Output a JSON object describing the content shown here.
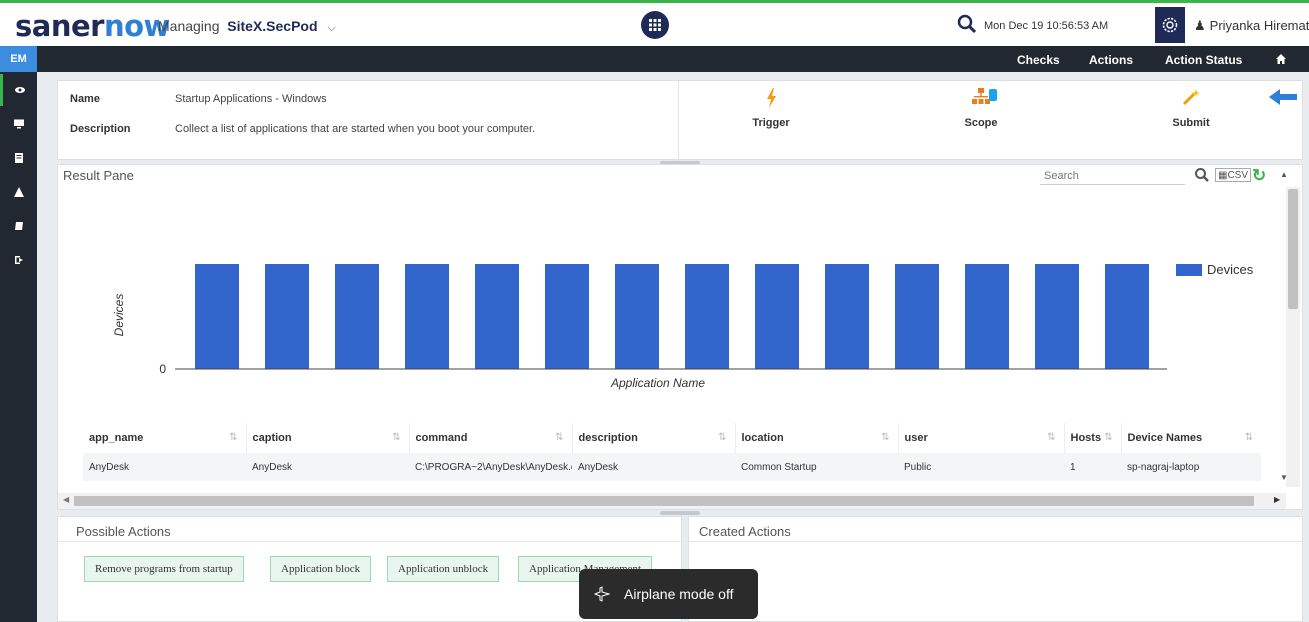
{
  "header": {
    "logo_part1": "saner",
    "logo_part2": "now",
    "managing_label": "Managing",
    "site_name": "SiteX.SecPod",
    "datetime": "Mon Dec 19  10:56:53 AM",
    "user_name": "Priyanka Hiremath"
  },
  "nav": {
    "module": "EM",
    "items": [
      "Checks",
      "Actions",
      "Action Status"
    ]
  },
  "sidebar": {
    "icons": [
      "eye-icon",
      "monitor-icon",
      "document-icon",
      "warning-icon",
      "book-icon",
      "exit-icon"
    ]
  },
  "check_info": {
    "name_label": "Name",
    "name_value": "Startup Applications - Windows",
    "description_label": "Description",
    "description_value": "Collect a list of applications that are started when you boot your computer.",
    "trigger_label": "Trigger",
    "scope_label": "Scope",
    "submit_label": "Submit"
  },
  "result_pane": {
    "title": "Result Pane",
    "search_placeholder": "Search",
    "csv_label": "CSV"
  },
  "chart_data": {
    "type": "bar",
    "xlabel": "Application Name",
    "ylabel": "Devices",
    "legend": [
      "Devices"
    ],
    "legend_position": "top-right",
    "y_ticks": [
      "0"
    ],
    "series_color": "#3366cc",
    "series": [
      {
        "name": "Devices",
        "values": [
          1,
          1,
          1,
          1,
          1,
          1,
          1,
          1,
          1,
          1,
          1,
          1,
          1,
          1
        ]
      }
    ]
  },
  "table": {
    "columns": [
      "app_name",
      "caption",
      "command",
      "description",
      "location",
      "user",
      "Hosts",
      "Device Names"
    ],
    "rows": [
      [
        "AnyDesk",
        "AnyDesk",
        "C:\\PROGRA~2\\AnyDesk\\AnyDesk.e...",
        "AnyDesk",
        "Common Startup",
        "Public",
        "1",
        "sp-nagraj-laptop"
      ]
    ]
  },
  "possible_actions": {
    "title": "Possible Actions",
    "buttons": [
      "Remove programs from startup",
      "Application block",
      "Application unblock",
      "Application Management"
    ]
  },
  "created_actions": {
    "title": "Created Actions"
  },
  "toast": {
    "text": "Airplane mode off"
  },
  "colors": {
    "brand_green": "#3bb54a",
    "brand_navy": "#1f2a57",
    "bar_blue": "#3366cc"
  }
}
